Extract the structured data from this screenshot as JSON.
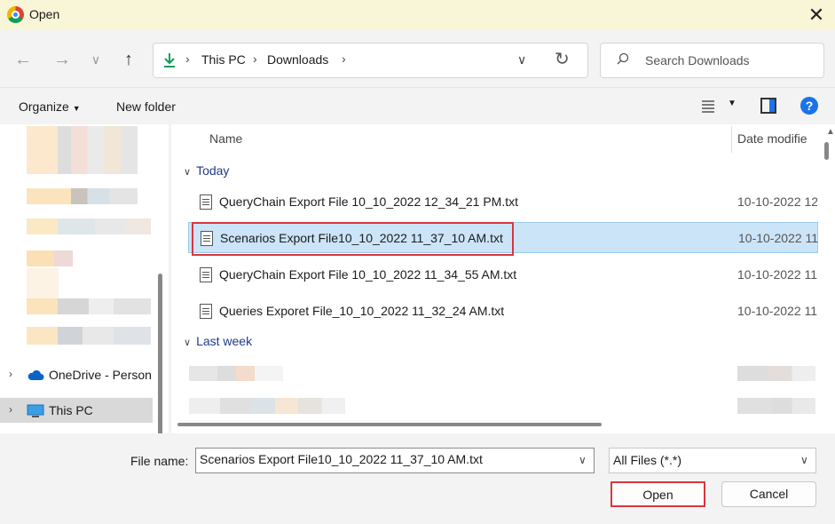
{
  "window": {
    "title": "Open",
    "close_symbol": "✕"
  },
  "nav": {
    "breadcrumb": [
      "This PC",
      "Downloads"
    ],
    "search_placeholder": "Search Downloads"
  },
  "toolbar": {
    "organize": "Organize",
    "new_folder": "New folder",
    "help": "?"
  },
  "sidebar": {
    "items": [
      {
        "label": "OneDrive - Person",
        "icon": "cloud-icon"
      },
      {
        "label": "This PC",
        "icon": "computer-icon",
        "selected": true
      }
    ]
  },
  "filelist": {
    "columns": {
      "name": "Name",
      "date": "Date modifie"
    },
    "groups": [
      {
        "label": "Today",
        "files": [
          {
            "name": "QueryChain Export File 10_10_2022 12_34_21 PM.txt",
            "date": "10-10-2022 12"
          },
          {
            "name": "Scenarios Export File10_10_2022 11_37_10 AM.txt",
            "date": "10-10-2022 11",
            "selected": true
          },
          {
            "name": "QueryChain Export File 10_10_2022 11_34_55 AM.txt",
            "date": "10-10-2022 11"
          },
          {
            "name": "Queries Exporet File_10_10_2022 11_32_24 AM.txt",
            "date": "10-10-2022 11"
          }
        ]
      },
      {
        "label": "Last week",
        "files": []
      }
    ]
  },
  "bottom": {
    "file_name_label": "File name:",
    "file_name_value": "Scenarios Export File10_10_2022 11_37_10 AM.txt",
    "file_type": "All Files (*.*)",
    "open_label": "Open",
    "cancel_label": "Cancel"
  },
  "colors": {
    "accent": "#1a73e8",
    "selection": "#cce4f7",
    "highlight_border": "#d9363e"
  }
}
